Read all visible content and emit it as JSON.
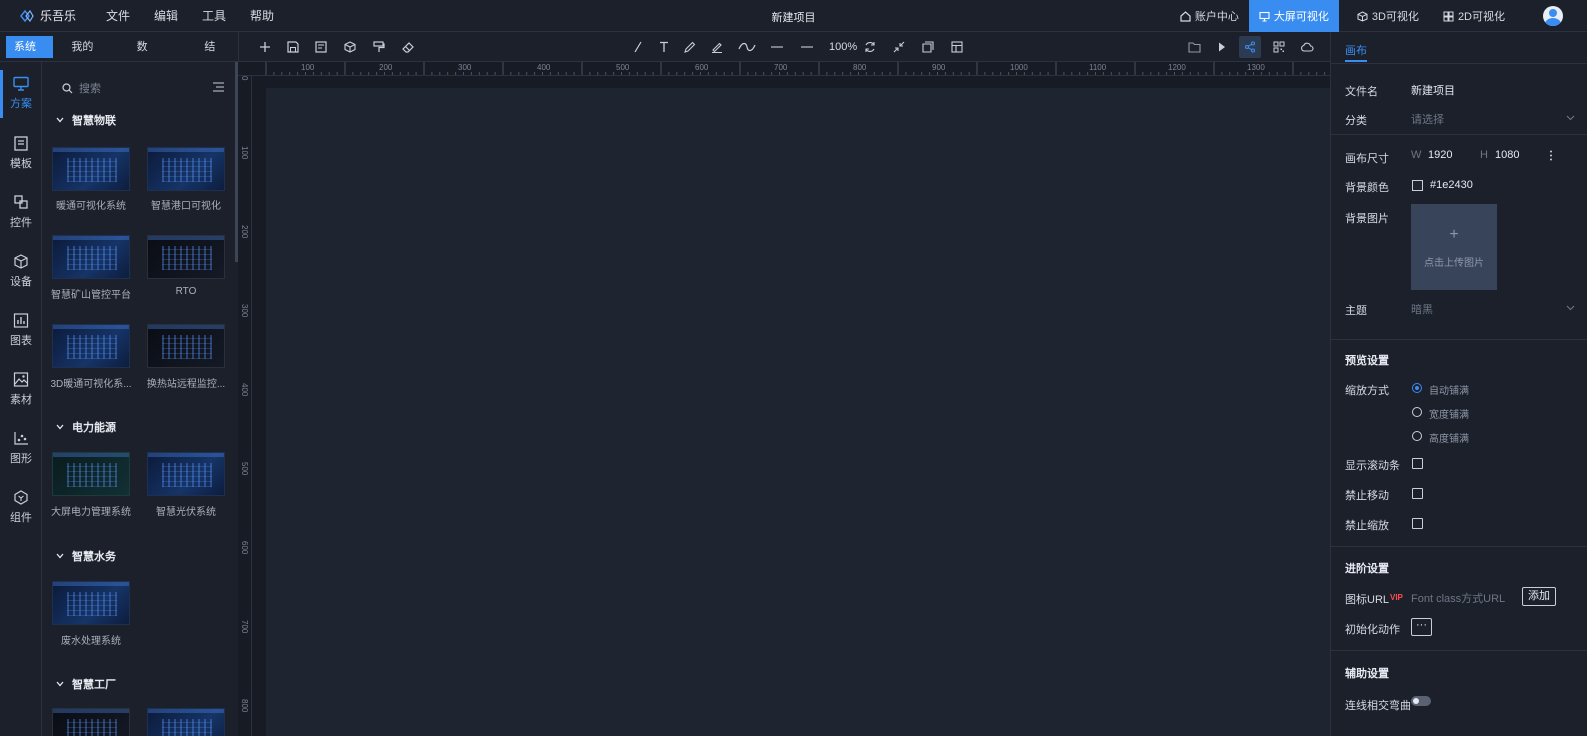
{
  "app": {
    "name": "乐吾乐",
    "project_title": "新建项目"
  },
  "menu": [
    "文件",
    "编辑",
    "工具",
    "帮助"
  ],
  "top_right": {
    "account": "账户中心",
    "bigscreen": "大屏可视化",
    "viz3d": "3D可视化",
    "viz2d": "2D可视化"
  },
  "left_tabs": [
    "系统资源",
    "我的资源",
    "数据",
    "结构"
  ],
  "rail": [
    "方案",
    "模板",
    "控件",
    "设备",
    "图表",
    "素材",
    "图形",
    "组件"
  ],
  "search": {
    "placeholder": "搜索"
  },
  "categories": [
    {
      "name": "智慧物联",
      "items": [
        "暖通可视化系统",
        "智慧港口可视化",
        "智慧矿山管控平台",
        "RTO",
        "3D暖通可视化系...",
        "换热站远程监控..."
      ]
    },
    {
      "name": "电力能源",
      "items": [
        "大屏电力管理系统",
        "智慧光伏系统"
      ]
    },
    {
      "name": "智慧水务",
      "items": [
        "废水处理系统"
      ]
    },
    {
      "name": "智慧工厂",
      "items": []
    }
  ],
  "toolbar": {
    "zoom": "100%"
  },
  "ruler": {
    "x": [
      "100",
      "200",
      "300",
      "400",
      "500",
      "600",
      "700",
      "800",
      "900",
      "1000",
      "1100",
      "1200",
      "1300"
    ],
    "y": [
      "0",
      "100",
      "200",
      "300",
      "400",
      "500",
      "600",
      "700",
      "800"
    ]
  },
  "props": {
    "tab": "画布",
    "file_name_label": "文件名",
    "file_name_value": "新建项目",
    "category_label": "分类",
    "category_placeholder": "请选择",
    "size_label": "画布尺寸",
    "w_label": "W",
    "w_value": "1920",
    "h_label": "H",
    "h_value": "1080",
    "bg_color_label": "背景颜色",
    "bg_color_value": "#1e2430",
    "bg_image_label": "背景图片",
    "upload_text": "点击上传图片",
    "upload_plus": "+",
    "theme_label": "主题",
    "theme_placeholder": "暗黑",
    "preview_section": "预览设置",
    "scale_label": "缩放方式",
    "scale_options": [
      "自动铺满",
      "宽度铺满",
      "高度铺满"
    ],
    "show_scroll_label": "显示滚动条",
    "disable_move_label": "禁止移动",
    "disable_zoom_label": "禁止缩放",
    "advanced_section": "进阶设置",
    "icon_url_label": "图标URL",
    "vip_badge": "VIP",
    "icon_url_placeholder": "Font class方式URL",
    "add_button": "添加",
    "init_action_label": "初始化动作",
    "more_button": "···",
    "assist_section": "辅助设置",
    "line_cross_label": "连线相交弯曲"
  },
  "colors": {
    "accent": "#3a8df0",
    "canvas_bg": "#1e2430"
  }
}
